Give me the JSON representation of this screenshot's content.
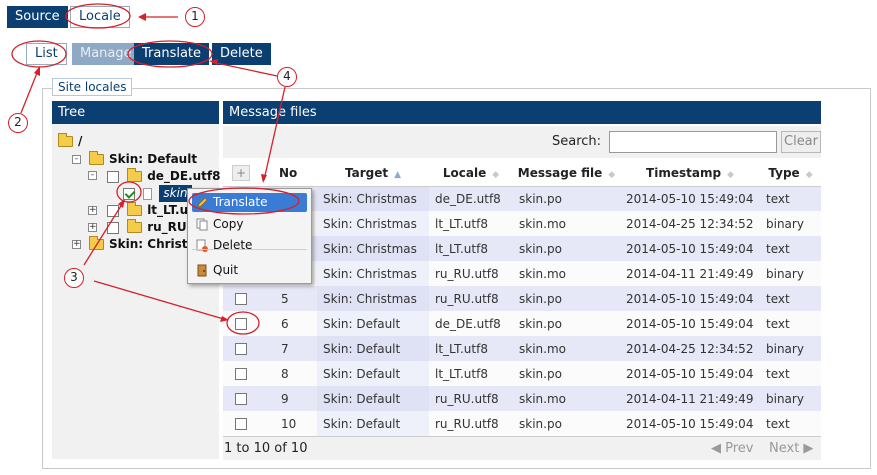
{
  "top_tabs": {
    "source": "Source",
    "locale": "Locale"
  },
  "sub_tabs": {
    "list": "List",
    "manage": "Manage",
    "translate": "Translate",
    "delete": "Delete"
  },
  "section_title": "Site locales",
  "tree": {
    "header": "Tree",
    "root": "/",
    "skin_default": "Skin: Default",
    "de_de": "de_DE.utf8",
    "skin_file": "skin",
    "lt_lt": "lt_LT.ut",
    "ru_ru": "ru_RU.",
    "skin_christmas": "Skin: Christm"
  },
  "grid": {
    "header": "Message files",
    "search_label": "Search:",
    "search_value": "",
    "clear_label": "Clear",
    "columns": {
      "no": "No",
      "target": "Target",
      "locale": "Locale",
      "file": "Message file",
      "timestamp": "Timestamp",
      "type": "Type"
    },
    "plus": "+",
    "rows": [
      {
        "no": "",
        "target": "Skin: Christmas",
        "locale": "de_DE.utf8",
        "file": "skin.po",
        "timestamp": "2014-05-10 15:49:04",
        "type": "text"
      },
      {
        "no": "",
        "target": "Skin: Christmas",
        "locale": "lt_LT.utf8",
        "file": "skin.mo",
        "timestamp": "2014-04-25 12:34:52",
        "type": "binary"
      },
      {
        "no": "",
        "target": "Skin: Christmas",
        "locale": "lt_LT.utf8",
        "file": "skin.po",
        "timestamp": "2014-05-10 15:49:04",
        "type": "text"
      },
      {
        "no": "",
        "target": "Skin: Christmas",
        "locale": "ru_RU.utf8",
        "file": "skin.mo",
        "timestamp": "2014-04-11 21:49:49",
        "type": "binary"
      },
      {
        "no": "5",
        "target": "Skin: Christmas",
        "locale": "ru_RU.utf8",
        "file": "skin.po",
        "timestamp": "2014-05-10 15:49:04",
        "type": "text"
      },
      {
        "no": "6",
        "target": "Skin: Default",
        "locale": "de_DE.utf8",
        "file": "skin.po",
        "timestamp": "2014-05-10 15:49:04",
        "type": "text"
      },
      {
        "no": "7",
        "target": "Skin: Default",
        "locale": "lt_LT.utf8",
        "file": "skin.mo",
        "timestamp": "2014-04-25 12:34:52",
        "type": "binary"
      },
      {
        "no": "8",
        "target": "Skin: Default",
        "locale": "lt_LT.utf8",
        "file": "skin.po",
        "timestamp": "2014-05-10 15:49:04",
        "type": "text"
      },
      {
        "no": "9",
        "target": "Skin: Default",
        "locale": "ru_RU.utf8",
        "file": "skin.mo",
        "timestamp": "2014-04-11 21:49:49",
        "type": "binary"
      },
      {
        "no": "10",
        "target": "Skin: Default",
        "locale": "ru_RU.utf8",
        "file": "skin.po",
        "timestamp": "2014-05-10 15:49:04",
        "type": "text"
      }
    ],
    "range_text": "1 to 10 of 10",
    "prev": "Prev",
    "next": "Next"
  },
  "context_menu": {
    "translate": "Translate",
    "copy": "Copy",
    "delete": "Delete",
    "quit": "Quit"
  },
  "callouts": {
    "c1": "1",
    "c2": "2",
    "c3": "3",
    "c4": "4"
  },
  "colors": {
    "nav": "#0b3f72",
    "callout": "#d4212b",
    "menu_highlight": "#3a7bd5",
    "row_alt": "#e6e8f7"
  }
}
